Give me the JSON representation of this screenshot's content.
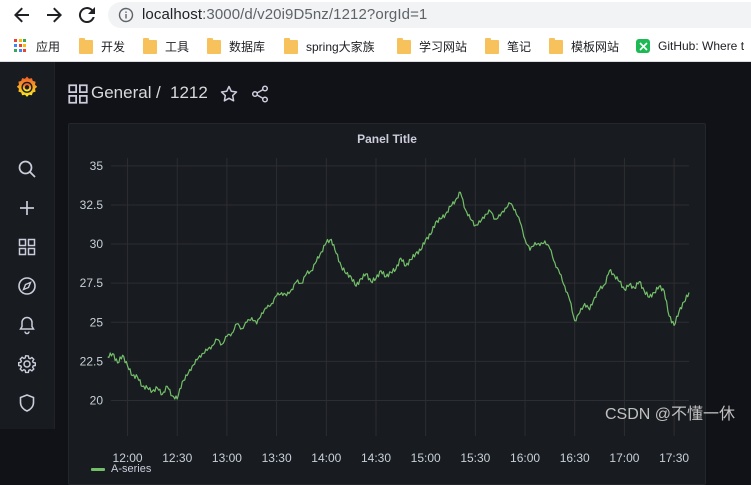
{
  "browser": {
    "url_host": "localhost",
    "url_rest": ":3000/d/v20i9D5nz/1212?orgId=1",
    "bookmarks": [
      {
        "label": "应用",
        "icon": "apps-icon"
      },
      {
        "label": "开发",
        "icon": "folder-icon"
      },
      {
        "label": "工具",
        "icon": "folder-icon"
      },
      {
        "label": "数据库",
        "icon": "folder-icon"
      },
      {
        "label": "spring大家族",
        "icon": "folder-icon"
      },
      {
        "label": "学习网站",
        "icon": "folder-icon"
      },
      {
        "label": "笔记",
        "icon": "folder-icon"
      },
      {
        "label": "模板网站",
        "icon": "folder-icon"
      },
      {
        "label": "GitHub: Where t",
        "icon": "github-icon"
      }
    ]
  },
  "dashboard": {
    "folder": "General",
    "separator": "/",
    "name": "1212"
  },
  "sidebar": {
    "items": [
      "search-icon",
      "plus-icon",
      "dashboards-icon",
      "explore-compass-icon",
      "alerting-bell-icon",
      "configuration-gear-icon",
      "server-admin-shield-icon"
    ]
  },
  "panel": {
    "title": "Panel Title",
    "legend_label": "A-series"
  },
  "colors": {
    "series": "#73bf69",
    "background": "#111217",
    "panel": "#181b1f",
    "grid": "#2c2e33",
    "logo": "#f46800"
  },
  "chart_data": {
    "type": "line",
    "title": "Panel Title",
    "x_ticks": [
      "12:00",
      "12:30",
      "13:00",
      "13:30",
      "14:00",
      "14:30",
      "15:00",
      "15:30",
      "16:00",
      "16:30",
      "17:00",
      "17:30"
    ],
    "y_ticks": [
      "20",
      "22.5",
      "25",
      "27.5",
      "30",
      "32.5",
      "35"
    ],
    "ylim": [
      18.5,
      35.5
    ],
    "xlim": [
      "11:50",
      "17:39"
    ],
    "grid": true,
    "legend_position": "bottom-left",
    "series": [
      {
        "name": "A-series",
        "x": [
          "11:48",
          "11:51",
          "11:54",
          "11:57",
          "12:00",
          "12:03",
          "12:06",
          "12:09",
          "12:12",
          "12:15",
          "12:18",
          "12:21",
          "12:24",
          "12:27",
          "12:30",
          "12:33",
          "12:36",
          "12:39",
          "12:42",
          "12:45",
          "12:48",
          "12:51",
          "12:54",
          "12:57",
          "13:00",
          "13:03",
          "13:06",
          "13:09",
          "13:12",
          "13:15",
          "13:18",
          "13:21",
          "13:24",
          "13:27",
          "13:30",
          "13:33",
          "13:36",
          "13:39",
          "13:42",
          "13:45",
          "13:48",
          "13:51",
          "13:54",
          "13:57",
          "14:00",
          "14:03",
          "14:06",
          "14:09",
          "14:12",
          "14:15",
          "14:18",
          "14:21",
          "14:24",
          "14:27",
          "14:30",
          "14:33",
          "14:36",
          "14:39",
          "14:42",
          "14:45",
          "14:48",
          "14:51",
          "14:54",
          "14:57",
          "15:00",
          "15:03",
          "15:06",
          "15:09",
          "15:12",
          "15:15",
          "15:18",
          "15:21",
          "15:24",
          "15:27",
          "15:30",
          "15:33",
          "15:36",
          "15:39",
          "15:42",
          "15:45",
          "15:48",
          "15:51",
          "15:54",
          "15:57",
          "16:00",
          "16:03",
          "16:06",
          "16:09",
          "16:12",
          "16:15",
          "16:18",
          "16:21",
          "16:24",
          "16:27",
          "16:30",
          "16:33",
          "16:36",
          "16:39",
          "16:42",
          "16:45",
          "16:48",
          "16:51",
          "16:54",
          "16:57",
          "17:00",
          "17:03",
          "17:06",
          "17:09",
          "17:12",
          "17:15",
          "17:18",
          "17:21",
          "17:24",
          "17:27",
          "17:30",
          "17:33",
          "17:36",
          "17:39"
        ],
        "values": [
          22.8,
          23.0,
          22.4,
          22.9,
          22.2,
          21.6,
          21.5,
          20.9,
          20.8,
          20.6,
          20.8,
          20.4,
          20.9,
          20.3,
          20.1,
          21.2,
          21.6,
          22.2,
          22.6,
          23.0,
          23.2,
          23.5,
          23.9,
          23.6,
          24.1,
          24.3,
          24.9,
          24.6,
          25.0,
          25.3,
          24.9,
          25.6,
          25.9,
          26.2,
          26.7,
          26.9,
          26.7,
          27.1,
          27.6,
          27.5,
          28.1,
          28.3,
          28.9,
          29.5,
          30.1,
          30.3,
          29.4,
          28.6,
          28.1,
          27.9,
          27.3,
          27.8,
          28.1,
          27.6,
          27.8,
          28.3,
          27.9,
          28.2,
          28.4,
          29.1,
          28.6,
          29.0,
          29.4,
          29.6,
          30.3,
          30.6,
          31.4,
          31.6,
          31.9,
          32.4,
          32.8,
          33.3,
          32.2,
          31.6,
          31.2,
          31.4,
          31.9,
          32.1,
          31.6,
          31.8,
          32.3,
          32.6,
          32.2,
          31.4,
          30.3,
          29.6,
          30.1,
          29.9,
          30.2,
          29.7,
          28.8,
          28.1,
          27.3,
          26.4,
          25.1,
          25.6,
          26.2,
          25.8,
          26.6,
          27.1,
          27.4,
          28.3,
          28.0,
          27.6,
          27.1,
          27.4,
          27.2,
          27.6,
          27.0,
          26.6,
          26.9,
          27.3,
          27.0,
          25.4,
          24.8,
          25.7,
          26.3,
          26.9
        ]
      }
    ]
  },
  "watermark": "CSDN @不懂一休"
}
